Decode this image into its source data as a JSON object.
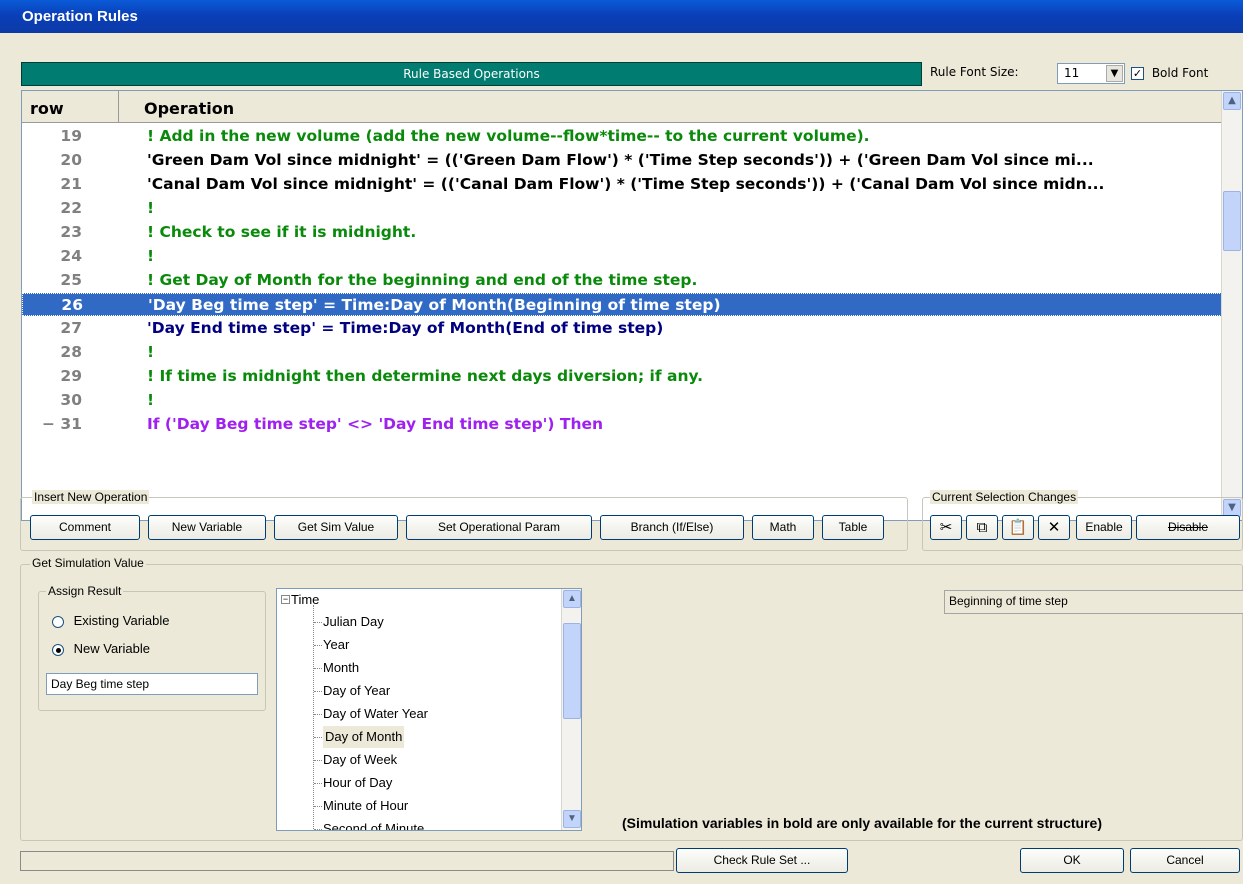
{
  "window": {
    "title": "Operation Rules"
  },
  "toolbar": {
    "banner": "Rule Based Operations",
    "font_size_label": "Rule Font Size:",
    "font_size_value": "11",
    "bold_font_label": "Bold Font",
    "bold_font_checked": true
  },
  "grid": {
    "col_row": "row",
    "col_operation": "Operation",
    "rows": [
      {
        "num": "19",
        "text": "! Add in the new volume (add the new volume--flow*time-- to the current volume).",
        "kind": "comment"
      },
      {
        "num": "20",
        "text": "'Green Dam Vol since midnight' = (('Green Dam Flow') * ('Time Step seconds')) + ('Green Dam Vol since mi...",
        "kind": "black"
      },
      {
        "num": "21",
        "text": "'Canal Dam Vol since midnight' = (('Canal Dam Flow') * ('Time Step seconds')) + ('Canal Dam Vol since midn...",
        "kind": "black"
      },
      {
        "num": "22",
        "text": "!",
        "kind": "comment"
      },
      {
        "num": "23",
        "text": "! Check to see if it is midnight.",
        "kind": "comment"
      },
      {
        "num": "24",
        "text": "!",
        "kind": "comment"
      },
      {
        "num": "25",
        "text": "! Get Day of Month for the beginning and end of the time step.",
        "kind": "comment"
      },
      {
        "num": "26",
        "text": "'Day Beg time step' = Time:Day of Month(Beginning of time step)",
        "kind": "selected"
      },
      {
        "num": "27",
        "text": "'Day End time step' = Time:Day of Month(End of time step)",
        "kind": "navy"
      },
      {
        "num": "28",
        "text": "!",
        "kind": "comment"
      },
      {
        "num": "29",
        "text": "! If time is midnight then determine next days diversion; if any.",
        "kind": "comment"
      },
      {
        "num": "30",
        "text": "!",
        "kind": "comment"
      },
      {
        "num": "− 31",
        "text": "If ('Day Beg time step' <> 'Day End time step') Then",
        "kind": "purple"
      }
    ]
  },
  "insert": {
    "legend": "Insert New Operation",
    "buttons": [
      "Comment",
      "New Variable",
      "Get Sim Value",
      "Set Operational Param",
      "Branch (If/Else)",
      "Math",
      "Table"
    ]
  },
  "selection": {
    "legend": "Current Selection Changes",
    "icons": [
      "cut-icon",
      "copy-icon",
      "paste-icon",
      "delete-icon"
    ],
    "enable_label": "Enable",
    "disable_label": "Disable"
  },
  "getsim": {
    "legend": "Get Simulation Value",
    "assign_legend": "Assign Result",
    "existing_label": "Existing Variable",
    "new_label": "New Variable",
    "selected_option": "New Variable",
    "variable_name": "Day Beg time step",
    "tree_root": "Time",
    "tree_items": [
      "Julian Day",
      "Year",
      "Month",
      "Day of Year",
      "Day of Water Year",
      "Day of Month",
      "Day of Week",
      "Hour of Day",
      "Minute of Hour",
      "Second of Minute"
    ],
    "tree_selected": "Day of Month",
    "param_value": "Beginning of time step",
    "hint": "(Simulation variables in bold are only available for the current structure)"
  },
  "footer": {
    "check_label": "Check Rule Set ...",
    "ok_label": "OK",
    "cancel_label": "Cancel"
  },
  "colors": {
    "banner": "#007c70",
    "selection": "#316ac5",
    "comment": "#0a8a0a",
    "navy": "#000080",
    "purple": "#a020f0"
  }
}
